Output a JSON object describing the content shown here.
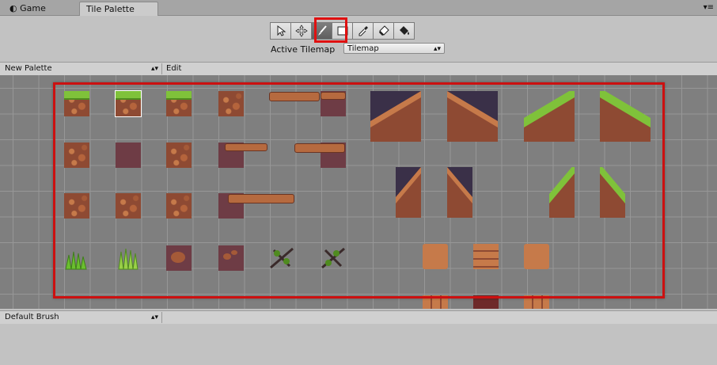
{
  "tabs": {
    "game_label": "Game",
    "palette_label": "Tile Palette"
  },
  "toolbar": {
    "tools": [
      {
        "name": "select-tool",
        "icon": "arrow-icon",
        "selected": false
      },
      {
        "name": "move-tool",
        "icon": "move-icon",
        "selected": false
      },
      {
        "name": "paint-tool",
        "icon": "brush-icon",
        "selected": true
      },
      {
        "name": "box-fill-tool",
        "icon": "rectangle-icon",
        "selected": false
      },
      {
        "name": "picker-tool",
        "icon": "eyedropper-icon",
        "selected": false
      },
      {
        "name": "erase-tool",
        "icon": "eraser-icon",
        "selected": false
      },
      {
        "name": "fill-tool",
        "icon": "bucket-icon",
        "selected": false
      }
    ],
    "active_tilemap_label": "Active Tilemap",
    "active_tilemap_value": "Tilemap"
  },
  "palette": {
    "selected": "New Palette",
    "edit_label": "Edit"
  },
  "brush": {
    "selected": "Default Brush"
  },
  "colors": {
    "highlight": "#e01010",
    "grass": "#7fc23a",
    "dirt": "#8e4a33"
  }
}
